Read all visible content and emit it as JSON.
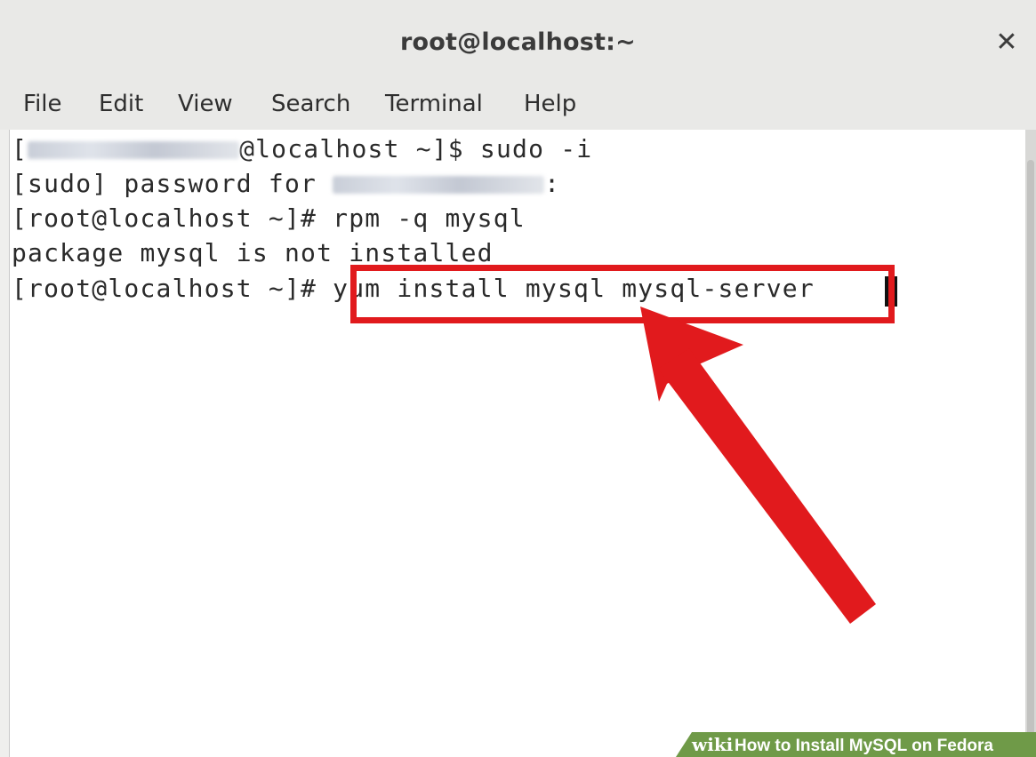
{
  "window": {
    "title": "root@localhost:~",
    "close_icon": "close-icon"
  },
  "menu": {
    "items": [
      "File",
      "Edit",
      "View",
      "Search",
      "Terminal",
      "Help"
    ]
  },
  "terminal": {
    "line1_open": "[",
    "line1_rest": "@localhost ~]$ sudo -i",
    "line2_prefix": "[sudo] password for ",
    "line2_suffix": ":",
    "line3": "[root@localhost ~]# rpm -q mysql",
    "line4": "package mysql is not installed",
    "line5_prompt": "[root@localhost ~]# ",
    "line5_command": "yum install mysql mysql-server"
  },
  "annotation": {
    "highlight_color": "#e11a1d",
    "arrow_color": "#e11a1d"
  },
  "watermark": {
    "brand": "wiki",
    "caption": "How to Install MySQL on Fedora"
  }
}
